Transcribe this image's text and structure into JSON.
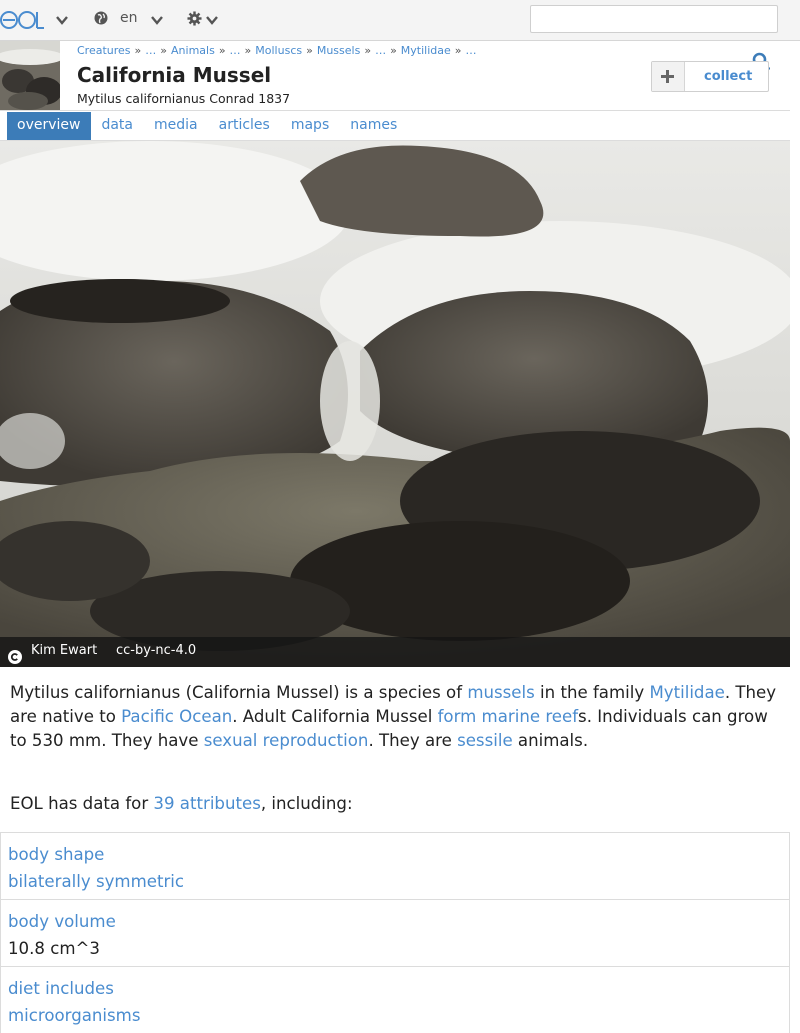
{
  "topbar": {
    "logo_text": "EOL",
    "language": "en",
    "search_placeholder": ""
  },
  "header": {
    "breadcrumb": [
      "Creatures",
      "…",
      "Animals",
      "…",
      "Molluscs",
      "Mussels",
      "…",
      "Mytilidae",
      "…"
    ],
    "title": "California Mussel",
    "scientific_name": "Mytilus californianus Conrad 1837",
    "collect_label": "collect"
  },
  "tabs": [
    "overview",
    "data",
    "media",
    "articles",
    "maps",
    "names"
  ],
  "media": {
    "author": "Kim Ewart",
    "license": "cc-by-nc-4.0"
  },
  "summary": {
    "s1": "Mytilus californianus (California Mussel) is a species of ",
    "l1": "mussels",
    "s2": " in the family ",
    "l2": "Mytilidae",
    "s3": ". They are native to ",
    "l3": "Pacific Ocean",
    "s4": ". Adult California Mussel ",
    "l4": "form marine reef",
    "s5": "s. Individuals can grow to 530 mm. They have ",
    "l5": "sexual reproduction",
    "s6": ". They are ",
    "l6": "sessile",
    "s7": " animals."
  },
  "attributes": {
    "prefix": "EOL has data for ",
    "link": "39 attributes",
    "suffix": ", including:"
  },
  "data_rows": [
    {
      "label": "body shape",
      "value": "bilaterally symmetric"
    },
    {
      "label": "body volume",
      "value": "10.8 cm^3"
    },
    {
      "label": "diet includes",
      "value": "microorganisms"
    }
  ],
  "colors": {
    "link": "#4a8ccf",
    "active_tab": "#3c7cb8"
  }
}
